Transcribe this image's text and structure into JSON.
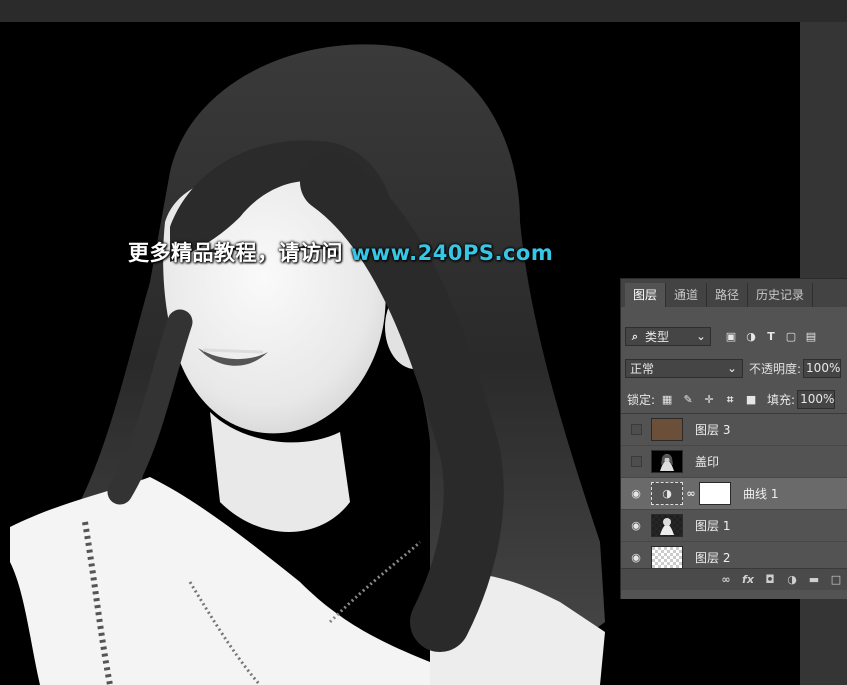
{
  "watermark": {
    "prefix": "更多精品教程，请访问",
    "url": "www.240PS.com"
  },
  "panel": {
    "tabs": [
      {
        "label": "图层",
        "active": true
      },
      {
        "label": "通道",
        "active": false
      },
      {
        "label": "路径",
        "active": false
      },
      {
        "label": "历史记录",
        "active": false
      }
    ],
    "filter": {
      "kind_label": "类型"
    },
    "blend_mode": "正常",
    "opacity_label": "不透明度:",
    "opacity_value": "100%",
    "lock_label": "锁定:",
    "fill_label": "填充:",
    "fill_value": "100%",
    "layers": [
      {
        "name": "图层 3",
        "visible": false,
        "selected": false,
        "thumb": "brown-fill",
        "color": "#6b4f38"
      },
      {
        "name": "盖印",
        "visible": false,
        "selected": false,
        "thumb": "portrait"
      },
      {
        "name": "曲线 1",
        "visible": true,
        "selected": true,
        "thumb": "curves-adjustment"
      },
      {
        "name": "图层 1",
        "visible": true,
        "selected": false,
        "thumb": "portrait-transparent"
      },
      {
        "name": "图层 2",
        "visible": true,
        "selected": false,
        "thumb": "transparent-pattern"
      }
    ]
  },
  "icons": {
    "filter": "search-icon",
    "footer": [
      "link-icon",
      "fx-icon",
      "mask-icon",
      "adjustment-icon",
      "folder-icon",
      "new-layer-icon"
    ]
  },
  "colors": {
    "panel_bg": "#535353",
    "accent_url": "#36c7e6",
    "canvas_bg": "#000000"
  }
}
